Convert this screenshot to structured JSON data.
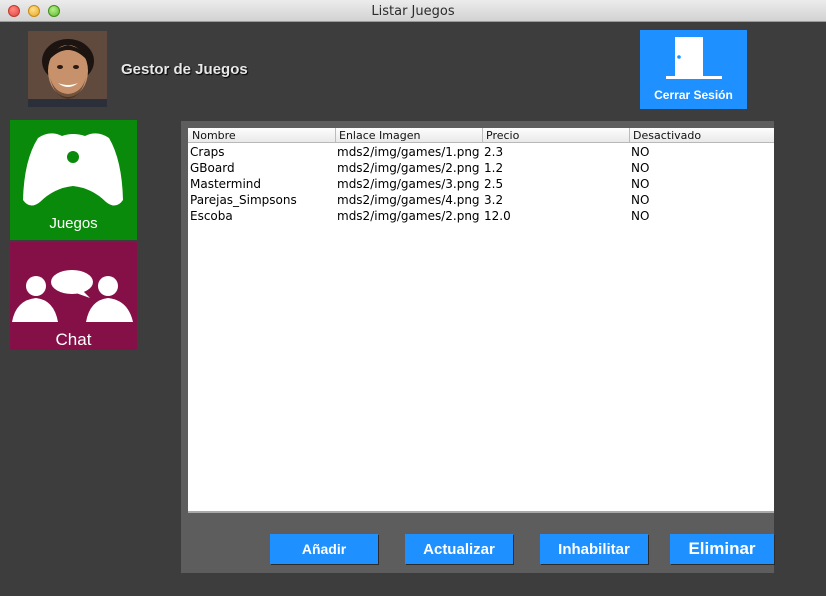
{
  "window": {
    "title": "Listar Juegos"
  },
  "header": {
    "app_title": "Gestor de Juegos",
    "logout_label": "Cerrar Sesión"
  },
  "sidebar": {
    "items": [
      {
        "label": "Juegos",
        "icon": "gamepad-icon",
        "color": "#0a8a0a"
      },
      {
        "label": "Chat",
        "icon": "chat-people-icon",
        "color": "#851048"
      }
    ]
  },
  "table": {
    "columns": [
      "Nombre",
      "Enlace Imagen",
      "Precio",
      "Desactivado"
    ],
    "rows": [
      [
        "Craps",
        "mds2/img/games/1.png",
        "2.3",
        "NO"
      ],
      [
        "GBoard",
        "mds2/img/games/2.png",
        "1.2",
        "NO"
      ],
      [
        "Mastermind",
        "mds2/img/games/3.png",
        "2.5",
        "NO"
      ],
      [
        "Parejas_Simpsons",
        "mds2/img/games/4.png",
        "3.2",
        "NO"
      ],
      [
        "Escoba",
        "mds2/img/games/2.png",
        "12.0",
        "NO"
      ]
    ]
  },
  "actions": {
    "add": "Añadir",
    "update": "Actualizar",
    "disable": "Inhabilitar",
    "delete": "Eliminar"
  },
  "colors": {
    "accent": "#1e90ff",
    "games_tile": "#0a8a0a",
    "chat_tile": "#851048",
    "background": "#3d3d3d"
  }
}
